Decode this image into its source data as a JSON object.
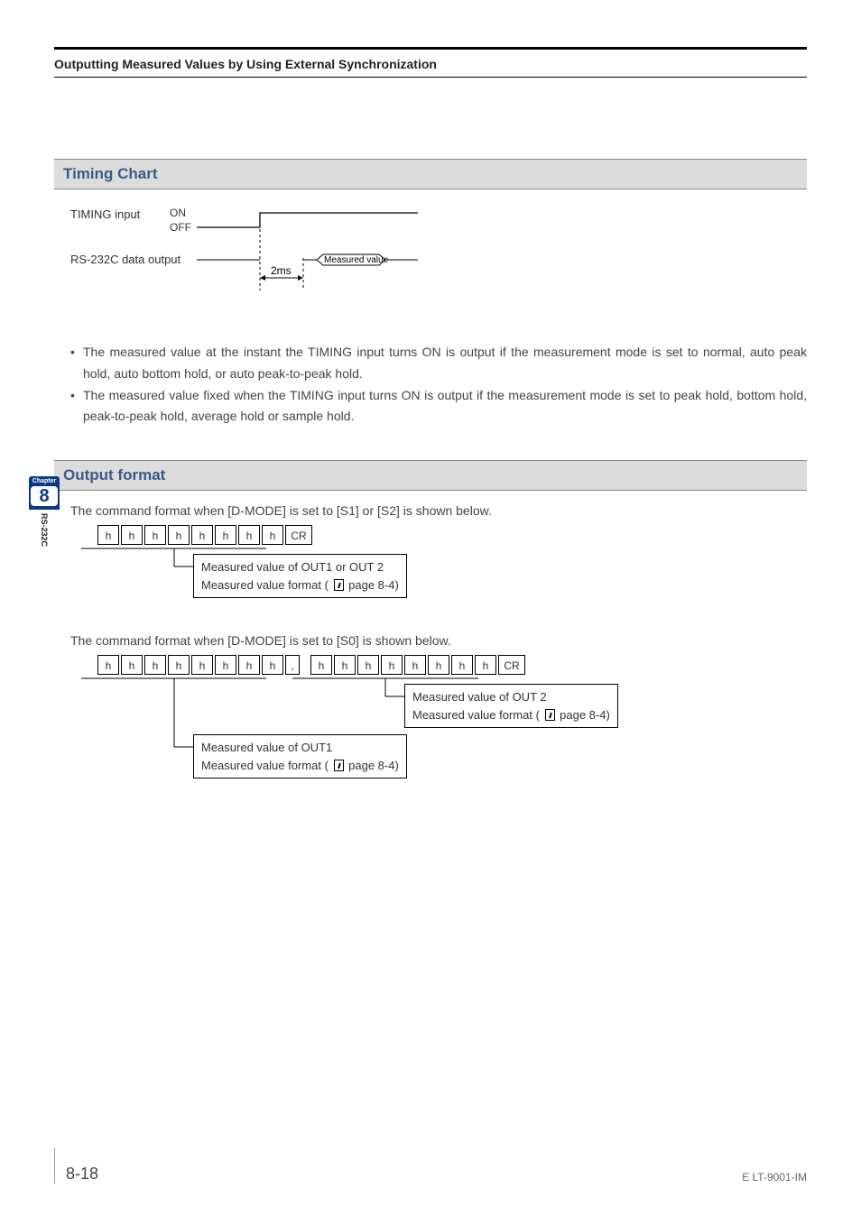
{
  "header": {
    "title": "Outputting Measured Values by Using External Synchronization"
  },
  "sideTab": {
    "chapterLabel": "Chapter",
    "chapterNum": "8",
    "subLabel": "RS-232C"
  },
  "section1": {
    "title": "Timing Chart",
    "timingInputLabel": "TIMING input",
    "on": "ON",
    "off": "OFF",
    "rsLabel": "RS-232C data output",
    "measured": "Measured value",
    "delay": "2ms",
    "bullets": [
      "The measured value at the instant the TIMING input turns ON is output if the measurement mode is set to normal, auto peak hold, auto bottom hold, or auto peak-to-peak hold.",
      "The measured value fixed when the TIMING input turns ON is output if the measurement mode is set to peak hold, bottom hold, peak-to-peak hold, average hold or sample hold."
    ]
  },
  "section2": {
    "title": "Output format",
    "para1": "The command format when [D-MODE] is set to [S1] or [S2] is shown below.",
    "para2": "The command format when [D-MODE] is set to [S0] is shown below.",
    "byteH": "h",
    "byteCR": "CR",
    "byteComma": ",",
    "callout1_l1": "Measured value of OUT1 or OUT 2",
    "callout1_l2_a": "Measured value format ( ",
    "callout1_l2_b": " page 8-4)",
    "callout2a_l1": "Measured value of OUT1",
    "callout2b_l1": "Measured value of OUT 2"
  },
  "footer": {
    "page": "8-18",
    "doc": "E LT-9001-IM"
  },
  "chart_data": {
    "type": "timing-diagram",
    "signals": [
      {
        "name": "TIMING input",
        "states": [
          "OFF",
          "ON"
        ],
        "transitions": [
          {
            "at": 0,
            "to": "ON"
          }
        ]
      },
      {
        "name": "RS-232C data output",
        "event": "Measured value",
        "delay_from_timing_on": "2ms"
      }
    ]
  }
}
